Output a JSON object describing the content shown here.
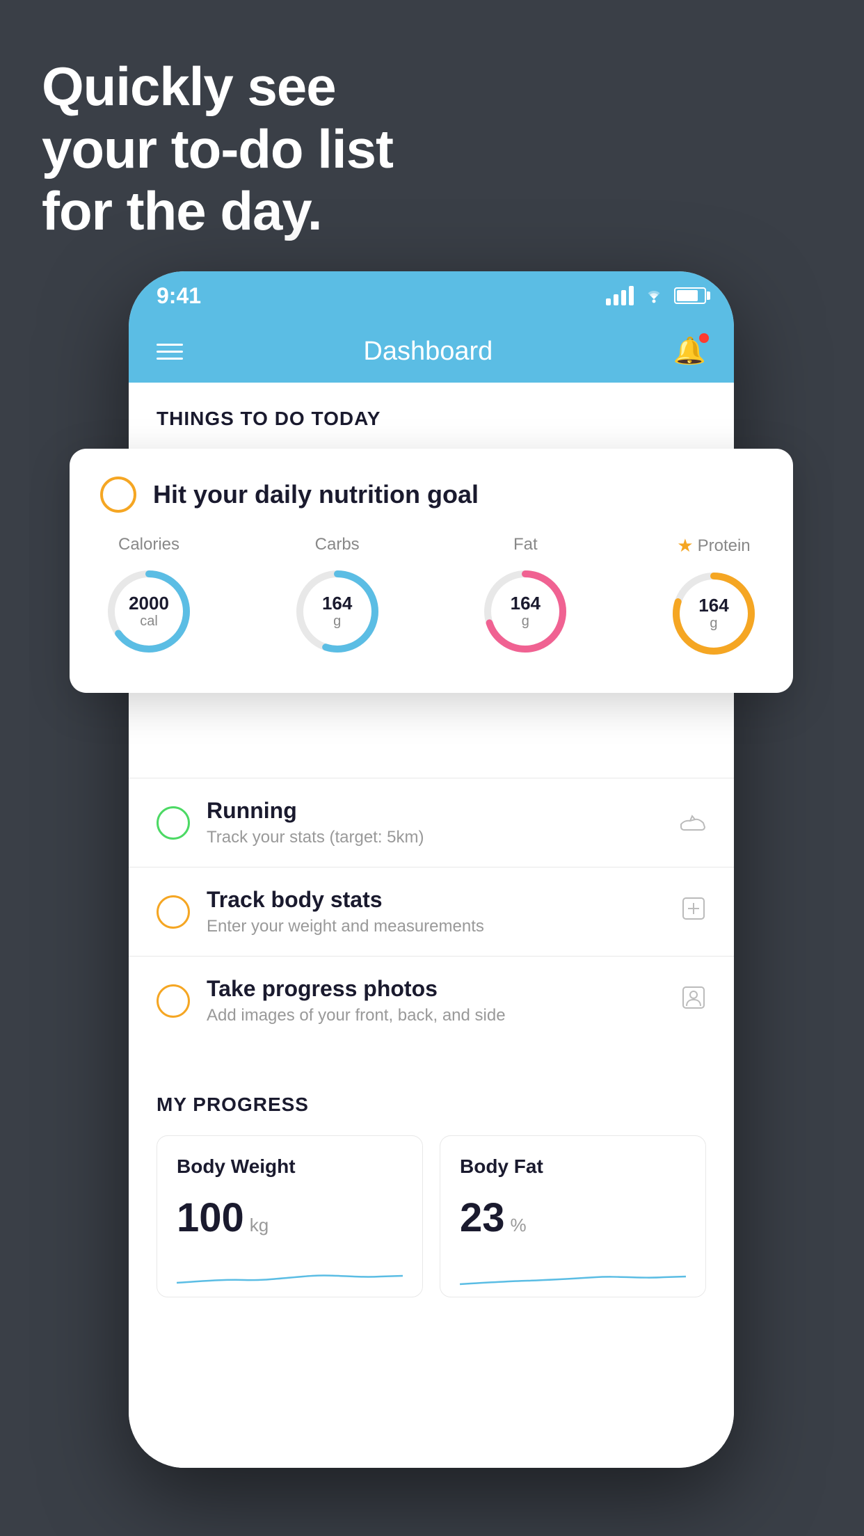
{
  "headline": {
    "line1": "Quickly see",
    "line2": "your to-do list",
    "line3": "for the day."
  },
  "statusBar": {
    "time": "9:41"
  },
  "navBar": {
    "title": "Dashboard"
  },
  "sectionHeader": "THINGS TO DO TODAY",
  "floatingCard": {
    "checkCircleColor": "#f5a623",
    "title": "Hit your daily nutrition goal",
    "nutrition": [
      {
        "label": "Calories",
        "value": "2000",
        "unit": "cal",
        "color": "#5bbde4",
        "percent": 65
      },
      {
        "label": "Carbs",
        "value": "164",
        "unit": "g",
        "color": "#5bbde4",
        "percent": 55
      },
      {
        "label": "Fat",
        "value": "164",
        "unit": "g",
        "color": "#f06292",
        "percent": 70
      },
      {
        "label": "Protein",
        "value": "164",
        "unit": "g",
        "color": "#f5a623",
        "percent": 80,
        "starred": true
      }
    ]
  },
  "todoItems": [
    {
      "title": "Running",
      "subtitle": "Track your stats (target: 5km)",
      "circleColor": "#4cd964",
      "icon": "shoe"
    },
    {
      "title": "Track body stats",
      "subtitle": "Enter your weight and measurements",
      "circleColor": "#f5a623",
      "icon": "scale"
    },
    {
      "title": "Take progress photos",
      "subtitle": "Add images of your front, back, and side",
      "circleColor": "#f5a623",
      "icon": "person"
    }
  ],
  "progress": {
    "header": "MY PROGRESS",
    "cards": [
      {
        "title": "Body Weight",
        "value": "100",
        "unit": "kg"
      },
      {
        "title": "Body Fat",
        "value": "23",
        "unit": "%"
      }
    ]
  }
}
